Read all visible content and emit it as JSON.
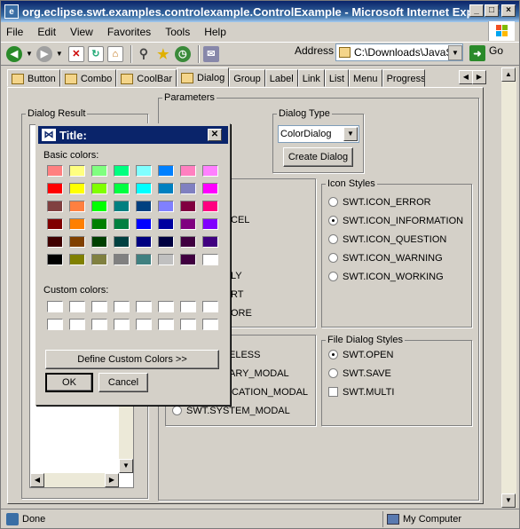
{
  "window": {
    "title": "org.eclipse.swt.examples.controlexample.ControlExample - Microsoft Internet Explorer ...",
    "min": "_",
    "max": "□",
    "close": "×"
  },
  "menu": [
    "File",
    "Edit",
    "View",
    "Favorites",
    "Tools",
    "Help"
  ],
  "toolbar": {
    "address_label": "Address",
    "address_value": "C:\\Downloads\\JavaSc",
    "go_label": "Go"
  },
  "tabs": [
    "Button",
    "Combo",
    "CoolBar",
    "Dialog",
    "Group",
    "Label",
    "Link",
    "List",
    "Menu",
    "ProgressB"
  ],
  "panel": {
    "dialog_result": "Dialog Result",
    "parameters": "Parameters",
    "dialog_type_legend": "Dialog Type",
    "dialog_type_value": "ColorDialog",
    "create_button": "Create Dialog",
    "icon_styles": {
      "legend": "Icon Styles",
      "items": [
        "SWT.ICON_ERROR",
        "SWT.ICON_INFORMATION",
        "SWT.ICON_QUESTION",
        "SWT.ICON_WARNING",
        "SWT.ICON_WORKING"
      ]
    },
    "button_styles_partial": [
      "CEL",
      "LY",
      "RT",
      "ORE"
    ],
    "modal_partial": [
      "ELESS",
      "ARY_MODAL",
      "ICATION_MODAL",
      "SWT.SYSTEM_MODAL"
    ],
    "file_dialog": {
      "legend": "File Dialog Styles",
      "items": [
        "SWT.OPEN",
        "SWT.SAVE",
        "SWT.MULTI"
      ]
    }
  },
  "dialog": {
    "title": "Title:",
    "basic_label": "Basic colors:",
    "custom_label": "Custom colors:",
    "define_button": "Define Custom Colors >>",
    "ok": "OK",
    "cancel": "Cancel",
    "basic_colors": [
      "#ff8080",
      "#ffff80",
      "#80ff80",
      "#00ff80",
      "#80ffff",
      "#0080ff",
      "#ff80c0",
      "#ff80ff",
      "#ff0000",
      "#ffff00",
      "#80ff00",
      "#00ff40",
      "#00ffff",
      "#0080c0",
      "#8080c0",
      "#ff00ff",
      "#804040",
      "#ff8040",
      "#00ff00",
      "#008080",
      "#004080",
      "#8080ff",
      "#800040",
      "#ff0080",
      "#800000",
      "#ff8000",
      "#008000",
      "#008040",
      "#0000ff",
      "#0000a0",
      "#800080",
      "#8000ff",
      "#400000",
      "#804000",
      "#004000",
      "#004040",
      "#000080",
      "#000040",
      "#400040",
      "#400080",
      "#000000",
      "#808000",
      "#808040",
      "#808080",
      "#408080",
      "#c0c0c0",
      "#400040",
      "#ffffff"
    ]
  },
  "status": {
    "text": "Done",
    "zone": "My Computer"
  }
}
